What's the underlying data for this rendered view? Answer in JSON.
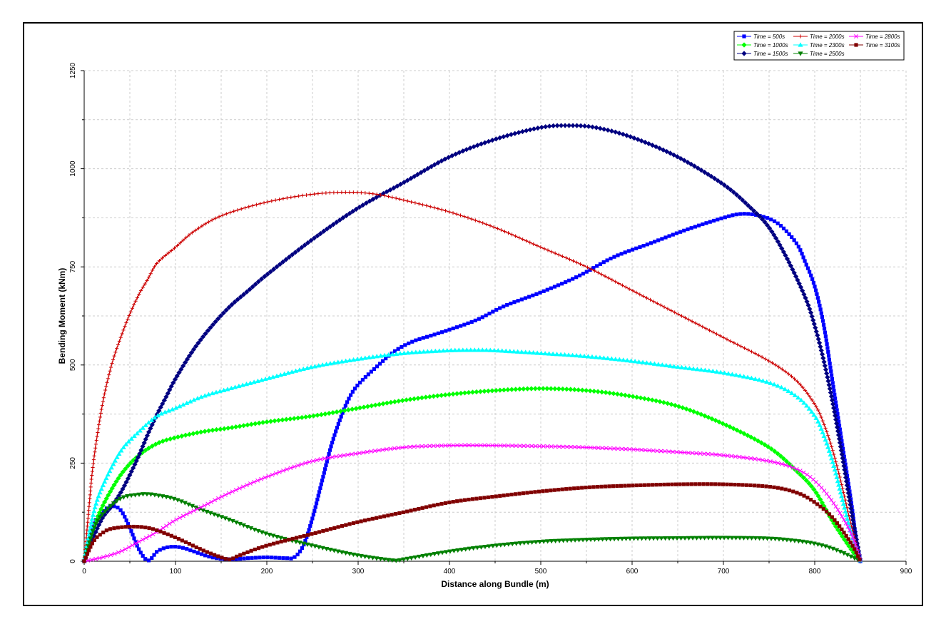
{
  "chart_data": {
    "type": "line",
    "xlabel": "Distance along Bundle (m)",
    "ylabel": "Bending Moment (kNm)",
    "xlim": [
      0,
      900
    ],
    "ylim": [
      0,
      1250
    ],
    "xticks": [
      0,
      100,
      200,
      300,
      400,
      500,
      600,
      700,
      800,
      900
    ],
    "yticks": [
      0,
      250,
      500,
      750,
      1000,
      1250
    ],
    "grid": true,
    "legend_position": "top-right",
    "series": [
      {
        "name": "Time = 500s",
        "color": "#0000FF",
        "marker": "square",
        "x": [
          0,
          10,
          20,
          30,
          40,
          50,
          60,
          70,
          80,
          90,
          100,
          110,
          120,
          140,
          160,
          180,
          200,
          220,
          230,
          240,
          250,
          260,
          270,
          280,
          290,
          300,
          320,
          340,
          360,
          380,
          400,
          430,
          460,
          500,
          540,
          580,
          620,
          660,
          700,
          720,
          740,
          760,
          780,
          790,
          800,
          810,
          820,
          830,
          840,
          845,
          850
        ],
        "y": [
          0,
          90,
          125,
          140,
          130,
          85,
          30,
          2,
          25,
          35,
          37,
          33,
          25,
          10,
          5,
          8,
          10,
          8,
          10,
          40,
          110,
          200,
          290,
          360,
          415,
          450,
          495,
          535,
          560,
          575,
          590,
          615,
          650,
          685,
          725,
          775,
          810,
          845,
          875,
          885,
          880,
          860,
          810,
          760,
          700,
          600,
          450,
          300,
          150,
          60,
          0
        ]
      },
      {
        "name": "Time = 1000s",
        "color": "#00FF00",
        "marker": "diamond",
        "x": [
          0,
          10,
          20,
          40,
          60,
          80,
          100,
          130,
          160,
          200,
          250,
          300,
          350,
          400,
          450,
          500,
          550,
          600,
          650,
          700,
          750,
          780,
          800,
          820,
          840,
          850
        ],
        "y": [
          0,
          80,
          140,
          220,
          270,
          300,
          315,
          330,
          340,
          355,
          370,
          390,
          410,
          425,
          435,
          440,
          435,
          420,
          395,
          350,
          290,
          230,
          180,
          100,
          30,
          0
        ]
      },
      {
        "name": "Time = 1500s",
        "color": "#000080",
        "marker": "diamond",
        "x": [
          0,
          10,
          20,
          30,
          40,
          50,
          60,
          70,
          80,
          90,
          100,
          120,
          140,
          160,
          180,
          200,
          250,
          300,
          350,
          400,
          450,
          500,
          530,
          560,
          600,
          650,
          700,
          730,
          750,
          770,
          790,
          800,
          810,
          820,
          830,
          840,
          850
        ],
        "y": [
          0,
          60,
          110,
          140,
          175,
          220,
          270,
          325,
          375,
          420,
          465,
          540,
          600,
          650,
          690,
          730,
          820,
          900,
          965,
          1030,
          1075,
          1105,
          1110,
          1105,
          1080,
          1030,
          960,
          900,
          850,
          770,
          670,
          600,
          510,
          400,
          270,
          130,
          0
        ]
      },
      {
        "name": "Time = 2000s",
        "color": "#CC0000",
        "marker": "plus",
        "x": [
          0,
          5,
          10,
          20,
          30,
          40,
          50,
          60,
          70,
          80,
          100,
          120,
          150,
          200,
          250,
          290,
          320,
          350,
          400,
          450,
          500,
          550,
          600,
          650,
          700,
          750,
          780,
          800,
          810,
          820,
          830,
          840,
          850
        ],
        "y": [
          0,
          130,
          250,
          400,
          500,
          570,
          630,
          680,
          720,
          760,
          800,
          840,
          880,
          915,
          935,
          940,
          935,
          920,
          890,
          850,
          800,
          750,
          690,
          630,
          570,
          510,
          460,
          400,
          350,
          280,
          190,
          90,
          0
        ]
      },
      {
        "name": "Time = 2300s",
        "color": "#00FFFF",
        "marker": "triangle-up",
        "x": [
          0,
          10,
          20,
          40,
          60,
          80,
          100,
          130,
          160,
          200,
          250,
          300,
          350,
          400,
          430,
          450,
          500,
          550,
          600,
          650,
          700,
          750,
          780,
          800,
          810,
          820,
          830,
          840,
          850
        ],
        "y": [
          0,
          120,
          190,
          280,
          330,
          370,
          390,
          420,
          440,
          465,
          495,
          515,
          530,
          537,
          538,
          537,
          530,
          522,
          510,
          495,
          480,
          455,
          420,
          370,
          320,
          250,
          160,
          70,
          0
        ]
      },
      {
        "name": "Time = 2500s",
        "color": "#008000",
        "marker": "triangle-down",
        "x": [
          0,
          10,
          20,
          40,
          60,
          70,
          80,
          100,
          130,
          160,
          200,
          250,
          300,
          340,
          350,
          400,
          450,
          500,
          550,
          600,
          650,
          700,
          750,
          780,
          800,
          820,
          840,
          850
        ],
        "y": [
          0,
          80,
          120,
          160,
          170,
          171,
          168,
          158,
          130,
          105,
          70,
          40,
          15,
          2,
          5,
          25,
          40,
          50,
          55,
          58,
          59,
          60,
          58,
          52,
          45,
          32,
          12,
          0
        ]
      },
      {
        "name": "Time = 2800s",
        "color": "#FF00FF",
        "marker": "cross",
        "x": [
          0,
          20,
          40,
          60,
          80,
          100,
          130,
          160,
          200,
          250,
          300,
          350,
          400,
          450,
          500,
          550,
          600,
          650,
          700,
          750,
          780,
          800,
          820,
          840,
          850
        ],
        "y": [
          0,
          10,
          25,
          50,
          75,
          105,
          140,
          175,
          215,
          255,
          275,
          290,
          295,
          295,
          293,
          290,
          285,
          278,
          270,
          255,
          235,
          205,
          150,
          70,
          0
        ]
      },
      {
        "name": "Time = 3100s",
        "color": "#800000",
        "marker": "square",
        "x": [
          0,
          10,
          20,
          30,
          50,
          70,
          90,
          110,
          130,
          150,
          160,
          170,
          200,
          250,
          300,
          350,
          400,
          450,
          500,
          550,
          600,
          650,
          700,
          750,
          780,
          800,
          820,
          840,
          850
        ],
        "y": [
          0,
          50,
          72,
          83,
          88,
          85,
          70,
          50,
          28,
          10,
          5,
          15,
          40,
          70,
          100,
          125,
          150,
          165,
          178,
          188,
          193,
          196,
          196,
          190,
          175,
          150,
          110,
          45,
          0
        ]
      }
    ]
  }
}
